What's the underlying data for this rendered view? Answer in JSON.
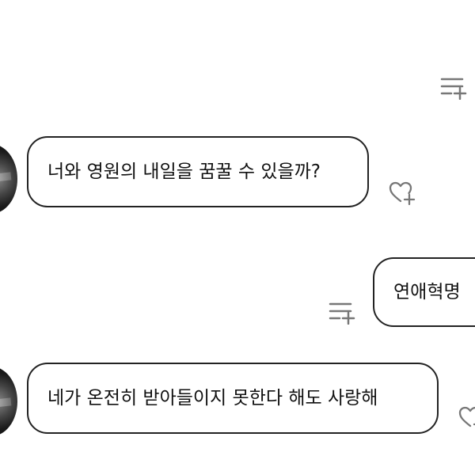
{
  "messages": [
    {
      "sender": "other",
      "text": "너와 영원의 내일을 꿈꿀 수 있을까?"
    },
    {
      "sender": "me",
      "text": "연애혁명"
    },
    {
      "sender": "other",
      "text": "네가 온전히 받아들이지 못한다 해도 사랑해"
    }
  ],
  "icons": {
    "menu": "playlist-add-icon",
    "reaction": "heart-plus-icon"
  },
  "colors": {
    "background": "#ffffff",
    "bubble_border": "#222222",
    "icon": "#777777"
  }
}
